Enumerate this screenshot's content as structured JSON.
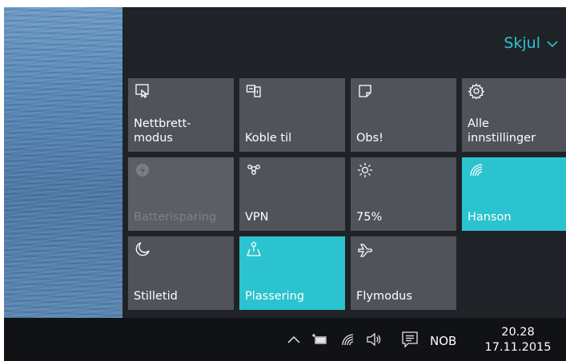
{
  "panel": {
    "collapse_label": "Skjul"
  },
  "tiles": [
    {
      "label": "Nettbrett-\nmodus",
      "icon": "tablet-mode-icon",
      "state": "normal"
    },
    {
      "label": "Koble til",
      "icon": "connect-icon",
      "state": "normal"
    },
    {
      "label": "Obs!",
      "icon": "note-icon",
      "state": "normal"
    },
    {
      "label": "Alle\ninnstillinger",
      "icon": "settings-gear-icon",
      "state": "normal"
    },
    {
      "label": "Batterisparing",
      "icon": "battery-saver-icon",
      "state": "disabled"
    },
    {
      "label": "VPN",
      "icon": "vpn-icon",
      "state": "normal"
    },
    {
      "label": "75%",
      "icon": "brightness-icon",
      "state": "normal"
    },
    {
      "label": "Hanson",
      "icon": "wifi-icon",
      "state": "active"
    },
    {
      "label": "Stilletid",
      "icon": "quiet-hours-moon-icon",
      "state": "normal"
    },
    {
      "label": "Plassering",
      "icon": "location-icon",
      "state": "active"
    },
    {
      "label": "Flymodus",
      "icon": "airplane-icon",
      "state": "normal"
    }
  ],
  "taskbar": {
    "language": "NOB",
    "time": "20.28",
    "date": "17.11.2015",
    "icons": [
      "chevron-up-icon",
      "battery-plug-icon",
      "wifi-icon",
      "volume-icon",
      "action-center-icon"
    ]
  },
  "colors": {
    "accent": "#2bc3cf",
    "tile": "#50545a",
    "panel": "#1f2327",
    "taskbar": "#101215"
  }
}
